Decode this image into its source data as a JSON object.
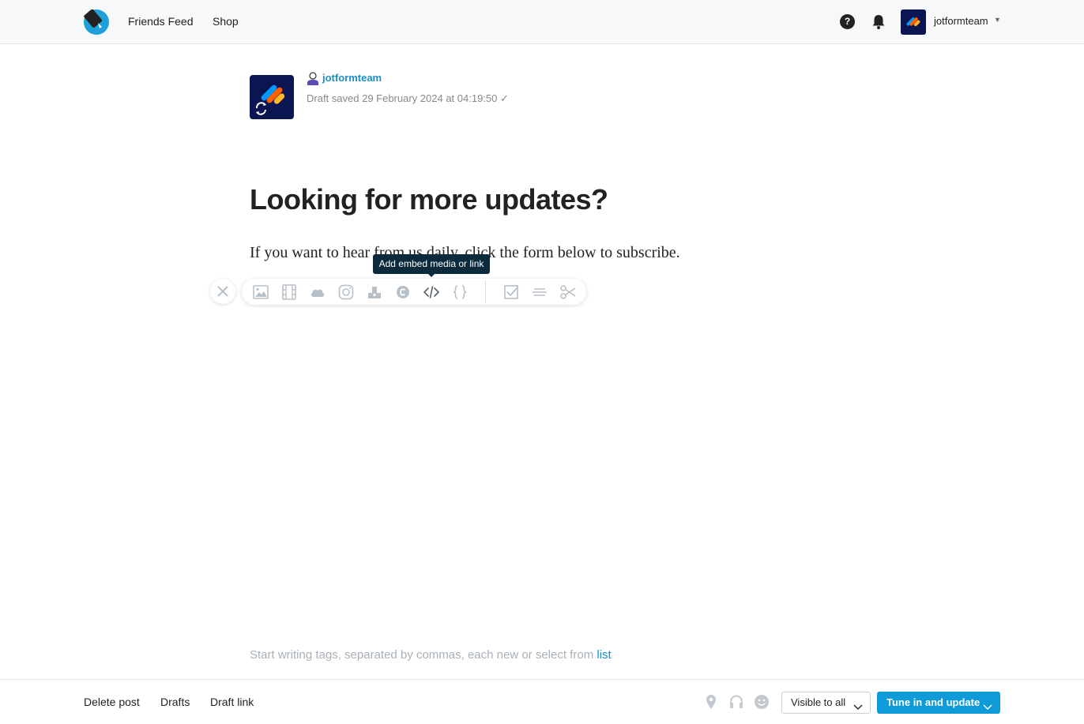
{
  "header": {
    "nav": [
      {
        "label": "Friends Feed"
      },
      {
        "label": "Shop"
      }
    ],
    "help_label": "?",
    "username": "jotformteam"
  },
  "post": {
    "author": "jotformteam",
    "draft_status": "Draft saved 29 February 2024 at 04:19:50 ✓",
    "title": "Looking for more updates?",
    "body": "If you want to hear from us daily, click the form below to subscribe."
  },
  "toolbar": {
    "tooltip": "Add embed media or link",
    "buttons": [
      {
        "icon": "image-icon"
      },
      {
        "icon": "video-icon"
      },
      {
        "icon": "cloud-icon"
      },
      {
        "icon": "instagram-icon"
      },
      {
        "icon": "upload-icon"
      },
      {
        "icon": "copyright-icon"
      },
      {
        "icon": "code-icon"
      },
      {
        "icon": "braces-icon"
      },
      {
        "icon": "checklist-icon"
      },
      {
        "icon": "separator-icon"
      },
      {
        "icon": "cut-icon"
      }
    ]
  },
  "tags": {
    "placeholder": "Start writing tags, separated by commas, each new or select from",
    "link_label": "list"
  },
  "footer": {
    "delete_label": "Delete post",
    "drafts_label": "Drafts",
    "draft_link_label": "Draft link",
    "visibility_label": "Visible to all",
    "publish_label": "Tune in and update"
  },
  "colors": {
    "accent": "#0f9bd7",
    "link": "#1a8fc7",
    "tooltip_bg": "#0b2a3b",
    "brand_dark": "#0a1551"
  }
}
